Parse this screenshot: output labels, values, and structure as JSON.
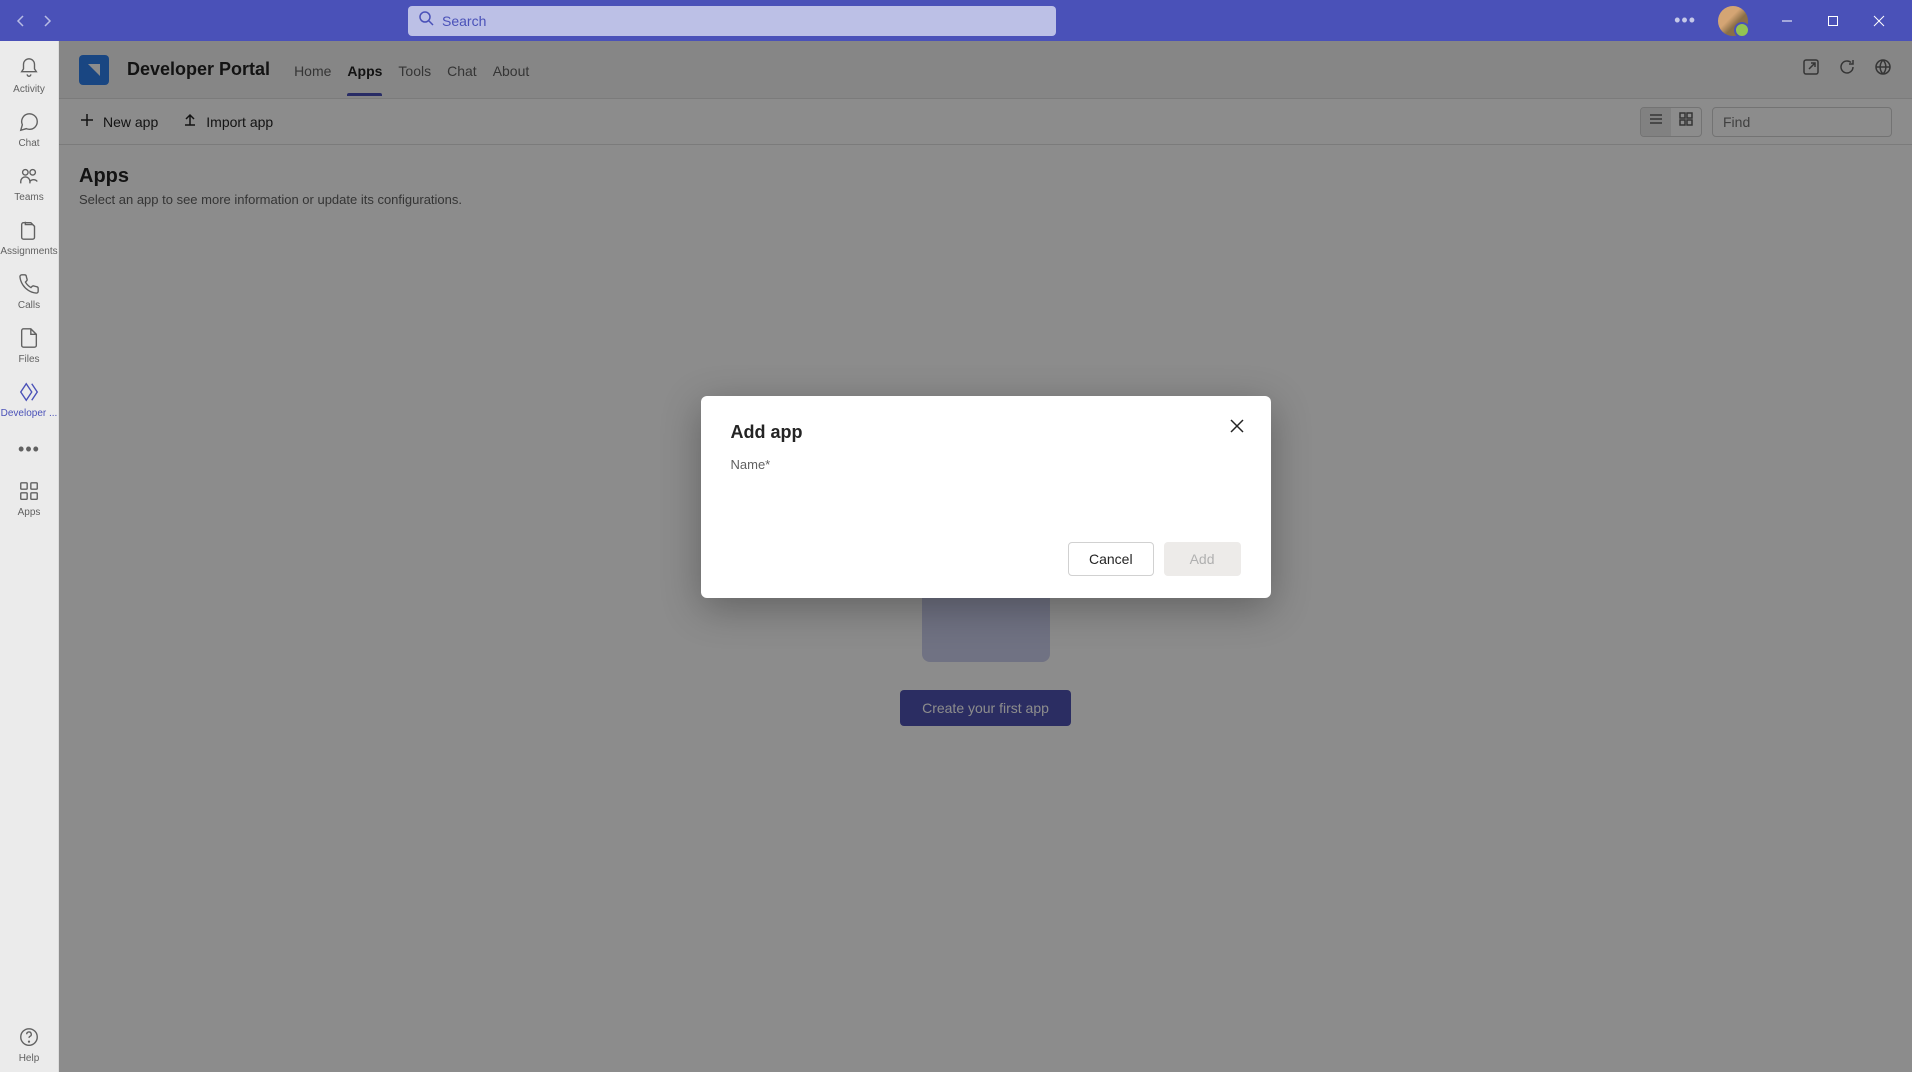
{
  "titlebar": {
    "search_placeholder": "Search"
  },
  "leftrail": {
    "items": [
      {
        "label": "Activity"
      },
      {
        "label": "Chat"
      },
      {
        "label": "Teams"
      },
      {
        "label": "Assignments"
      },
      {
        "label": "Calls"
      },
      {
        "label": "Files"
      },
      {
        "label": "Developer ..."
      },
      {
        "label": "Apps"
      },
      {
        "label": "Help"
      }
    ]
  },
  "subheader": {
    "app_title": "Developer Portal",
    "tabs": [
      {
        "label": "Home"
      },
      {
        "label": "Apps"
      },
      {
        "label": "Tools"
      },
      {
        "label": "Chat"
      },
      {
        "label": "About"
      }
    ]
  },
  "toolbar": {
    "new_app_label": "New app",
    "import_app_label": "Import app",
    "find_placeholder": "Find"
  },
  "page": {
    "title": "Apps",
    "subtitle": "Select an app to see more information or update its configurations.",
    "create_first_app_label": "Create your first app"
  },
  "modal": {
    "title": "Add app",
    "name_label": "Name*",
    "cancel_label": "Cancel",
    "add_label": "Add"
  }
}
